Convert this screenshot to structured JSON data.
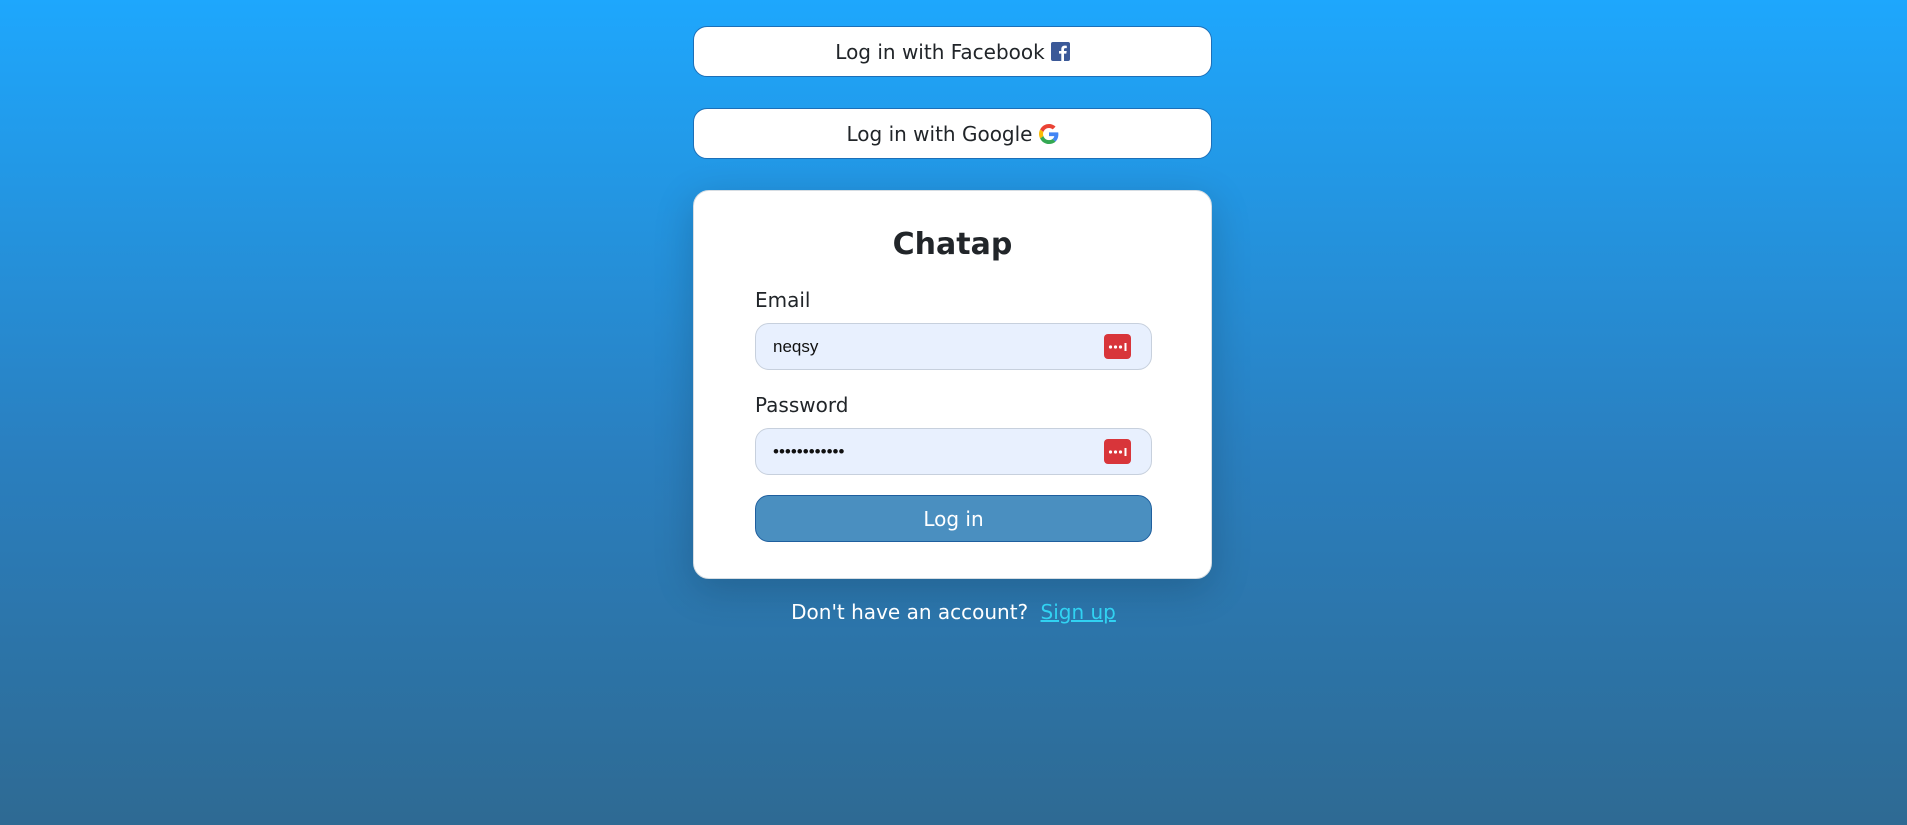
{
  "social": {
    "facebook_label": "Log in with Facebook",
    "google_label": "Log in with Google"
  },
  "card": {
    "title": "Chatap",
    "email_label": "Email",
    "email_value": "neqsy",
    "password_label": "Password",
    "password_value": "••••••••••••",
    "login_label": "Log in"
  },
  "footer": {
    "prompt": "Don't have an account?",
    "signup_link": "Sign up"
  },
  "colors": {
    "facebook": "#3b5998",
    "password_manager": "#d8353a",
    "link": "#31d2f2"
  },
  "icons": {
    "facebook": "facebook-icon",
    "google": "google-icon",
    "password_manager": "password-manager-icon"
  }
}
